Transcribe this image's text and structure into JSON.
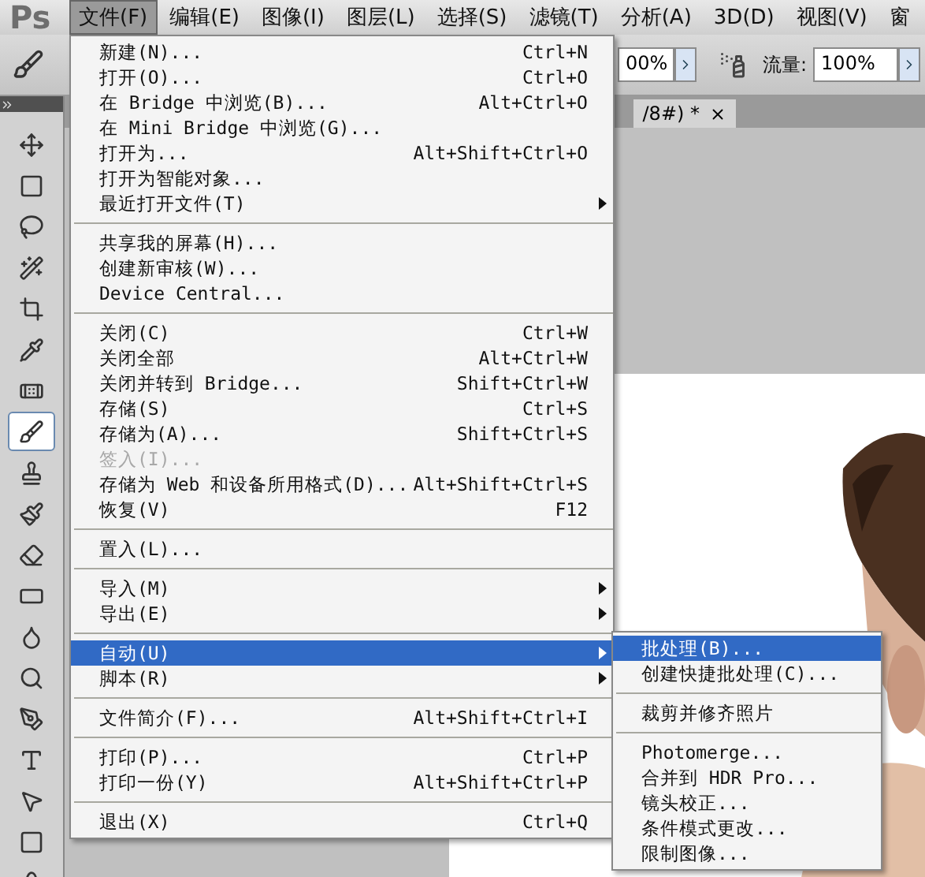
{
  "app_logo": "Ps",
  "menubar": [
    {
      "label": "文件(F)",
      "selected": true
    },
    {
      "label": "编辑(E)",
      "selected": false
    },
    {
      "label": "图像(I)",
      "selected": false
    },
    {
      "label": "图层(L)",
      "selected": false
    },
    {
      "label": "选择(S)",
      "selected": false
    },
    {
      "label": "滤镜(T)",
      "selected": false
    },
    {
      "label": "分析(A)",
      "selected": false
    },
    {
      "label": "3D(D)",
      "selected": false
    },
    {
      "label": "视图(V)",
      "selected": false
    },
    {
      "label": "窗",
      "selected": false
    }
  ],
  "options_bar": {
    "opacity_value": "00%",
    "flow_label": "流量:",
    "flow_value": "100%"
  },
  "document_tab": {
    "title": "/8#) *"
  },
  "tools": [
    {
      "kind": "move",
      "selected": false
    },
    {
      "kind": "marquee",
      "selected": false
    },
    {
      "kind": "lasso",
      "selected": false
    },
    {
      "kind": "wand",
      "selected": false
    },
    {
      "kind": "crop",
      "selected": false
    },
    {
      "kind": "eyedropper",
      "selected": false
    },
    {
      "kind": "heal",
      "selected": false
    },
    {
      "kind": "brush",
      "selected": true
    },
    {
      "kind": "stamp",
      "selected": false
    },
    {
      "kind": "history",
      "selected": false
    },
    {
      "kind": "eraser",
      "selected": false
    },
    {
      "kind": "gradient",
      "selected": false
    },
    {
      "kind": "blur",
      "selected": false
    },
    {
      "kind": "dodge",
      "selected": false
    },
    {
      "kind": "pen",
      "selected": false
    },
    {
      "kind": "type",
      "selected": false
    },
    {
      "kind": "select",
      "selected": false
    },
    {
      "kind": "shape",
      "selected": false
    },
    {
      "kind": "rotate3d",
      "selected": false
    }
  ],
  "file_menu": {
    "items": [
      {
        "kind": "item",
        "label": "新建(N)...",
        "shortcut": "Ctrl+N",
        "submenu": false,
        "disabled": false,
        "selected": false
      },
      {
        "kind": "item",
        "label": "打开(O)...",
        "shortcut": "Ctrl+O",
        "submenu": false,
        "disabled": false,
        "selected": false
      },
      {
        "kind": "item",
        "label": "在 Bridge 中浏览(B)...",
        "shortcut": "Alt+Ctrl+O",
        "submenu": false,
        "disabled": false,
        "selected": false
      },
      {
        "kind": "item",
        "label": "在 Mini Bridge 中浏览(G)...",
        "submenu": false,
        "disabled": false,
        "selected": false
      },
      {
        "kind": "item",
        "label": "打开为...",
        "shortcut": "Alt+Shift+Ctrl+O",
        "submenu": false,
        "disabled": false,
        "selected": false
      },
      {
        "kind": "item",
        "label": "打开为智能对象...",
        "submenu": false,
        "disabled": false,
        "selected": false
      },
      {
        "kind": "item",
        "label": "最近打开文件(T)",
        "submenu": true,
        "disabled": false,
        "selected": false
      },
      {
        "kind": "separator"
      },
      {
        "kind": "item",
        "label": "共享我的屏幕(H)...",
        "submenu": false,
        "disabled": false,
        "selected": false
      },
      {
        "kind": "item",
        "label": "创建新审核(W)...",
        "submenu": false,
        "disabled": false,
        "selected": false
      },
      {
        "kind": "item",
        "label": "Device Central...",
        "submenu": false,
        "disabled": false,
        "selected": false
      },
      {
        "kind": "separator"
      },
      {
        "kind": "item",
        "label": "关闭(C)",
        "shortcut": "Ctrl+W",
        "submenu": false,
        "disabled": false,
        "selected": false
      },
      {
        "kind": "item",
        "label": "关闭全部",
        "shortcut": "Alt+Ctrl+W",
        "submenu": false,
        "disabled": false,
        "selected": false
      },
      {
        "kind": "item",
        "label": "关闭并转到 Bridge...",
        "shortcut": "Shift+Ctrl+W",
        "submenu": false,
        "disabled": false,
        "selected": false
      },
      {
        "kind": "item",
        "label": "存储(S)",
        "shortcut": "Ctrl+S",
        "submenu": false,
        "disabled": false,
        "selected": false
      },
      {
        "kind": "item",
        "label": "存储为(A)...",
        "shortcut": "Shift+Ctrl+S",
        "submenu": false,
        "disabled": false,
        "selected": false
      },
      {
        "kind": "item",
        "label": "签入(I)...",
        "submenu": false,
        "disabled": true,
        "selected": false
      },
      {
        "kind": "item",
        "label": "存储为 Web 和设备所用格式(D)...",
        "shortcut": "Alt+Shift+Ctrl+S",
        "submenu": false,
        "disabled": false,
        "selected": false
      },
      {
        "kind": "item",
        "label": "恢复(V)",
        "shortcut": "F12",
        "submenu": false,
        "disabled": false,
        "selected": false
      },
      {
        "kind": "separator"
      },
      {
        "kind": "item",
        "label": "置入(L)...",
        "submenu": false,
        "disabled": false,
        "selected": false
      },
      {
        "kind": "separator"
      },
      {
        "kind": "item",
        "label": "导入(M)",
        "submenu": true,
        "disabled": false,
        "selected": false
      },
      {
        "kind": "item",
        "label": "导出(E)",
        "submenu": true,
        "disabled": false,
        "selected": false
      },
      {
        "kind": "separator"
      },
      {
        "kind": "item",
        "label": "自动(U)",
        "submenu": true,
        "disabled": false,
        "selected": true
      },
      {
        "kind": "item",
        "label": "脚本(R)",
        "submenu": true,
        "disabled": false,
        "selected": false
      },
      {
        "kind": "separator"
      },
      {
        "kind": "item",
        "label": "文件简介(F)...",
        "shortcut": "Alt+Shift+Ctrl+I",
        "submenu": false,
        "disabled": false,
        "selected": false
      },
      {
        "kind": "separator"
      },
      {
        "kind": "item",
        "label": "打印(P)...",
        "shortcut": "Ctrl+P",
        "submenu": false,
        "disabled": false,
        "selected": false
      },
      {
        "kind": "item",
        "label": "打印一份(Y)",
        "shortcut": "Alt+Shift+Ctrl+P",
        "submenu": false,
        "disabled": false,
        "selected": false
      },
      {
        "kind": "separator"
      },
      {
        "kind": "item",
        "label": "退出(X)",
        "shortcut": "Ctrl+Q",
        "submenu": false,
        "disabled": false,
        "selected": false
      }
    ]
  },
  "automate_submenu": {
    "items": [
      {
        "kind": "item",
        "label": "批处理(B)...",
        "selected": true
      },
      {
        "kind": "item",
        "label": "创建快捷批处理(C)...",
        "selected": false
      },
      {
        "kind": "separator"
      },
      {
        "kind": "item",
        "label": "裁剪并修齐照片",
        "selected": false
      },
      {
        "kind": "separator"
      },
      {
        "kind": "item",
        "label": "Photomerge...",
        "selected": false
      },
      {
        "kind": "item",
        "label": "合并到 HDR Pro...",
        "selected": false
      },
      {
        "kind": "item",
        "label": "镜头校正...",
        "selected": false
      },
      {
        "kind": "item",
        "label": "条件模式更改...",
        "selected": false
      },
      {
        "kind": "item",
        "label": "限制图像...",
        "selected": false
      }
    ]
  }
}
